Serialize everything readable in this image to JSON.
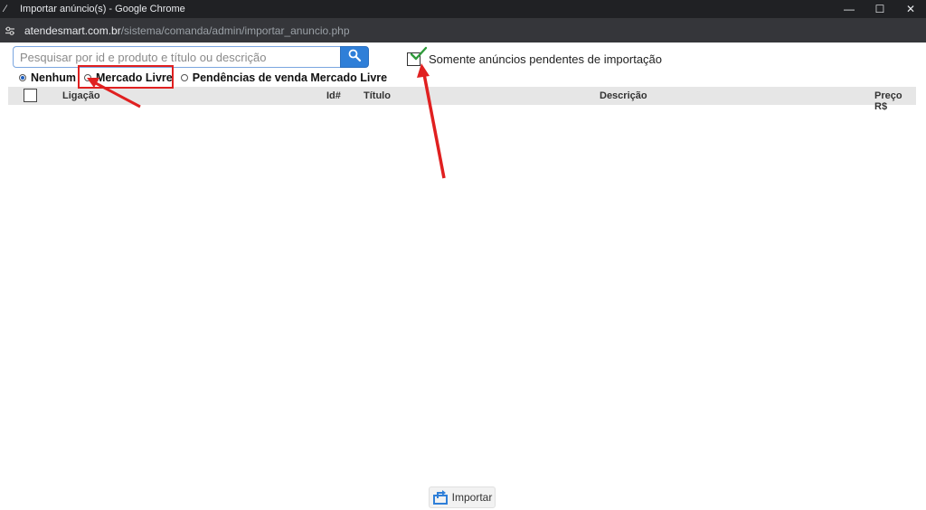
{
  "window": {
    "title": "Importar anúncio(s) - Google Chrome",
    "controls": {
      "minimize": "—",
      "maximize": "☐",
      "close": "✕"
    }
  },
  "addressbar": {
    "host": "atendesmart.com.br",
    "path": "/sistema/comanda/admin/importar_anuncio.php"
  },
  "search": {
    "placeholder": "Pesquisar por id e produto e título ou descrição",
    "value": ""
  },
  "filters": {
    "pending_only": {
      "label": "Somente anúncios pendentes de importação",
      "checked": true
    },
    "sources": [
      {
        "label": "Nenhum",
        "checked": true
      },
      {
        "label": "Mercado Livre",
        "checked": false
      },
      {
        "label": "Pendências de venda Mercado Livre",
        "checked": false
      }
    ]
  },
  "table": {
    "columns": [
      "Ligação",
      "Id#",
      "Título",
      "Descrição",
      "Preço R$"
    ],
    "rows": []
  },
  "footer": {
    "import_label": "Importar"
  },
  "colors": {
    "accent": "#2f7fd8",
    "annotation": "#e02020",
    "check": "#2e9a3a"
  },
  "icons": {
    "search": "search-icon",
    "import": "import-icon",
    "check": "checkmark-icon"
  }
}
